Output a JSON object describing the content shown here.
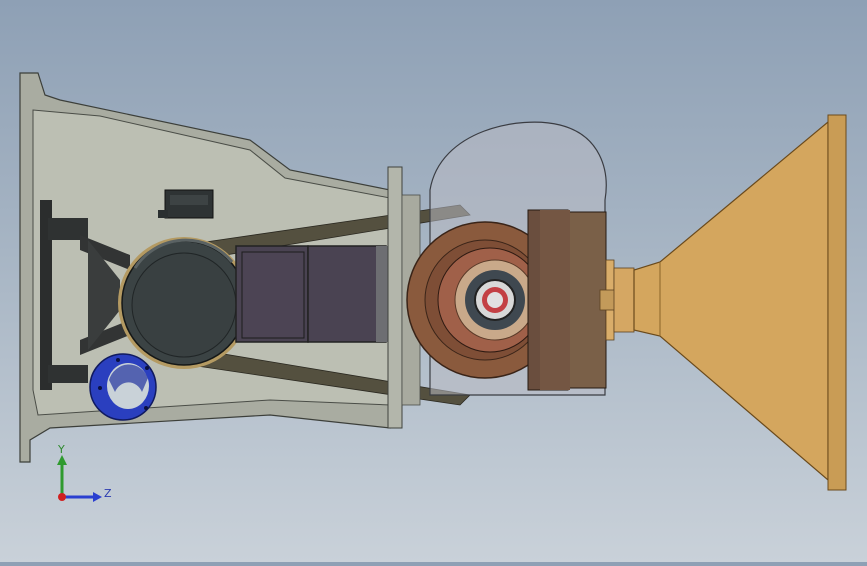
{
  "viewport": {
    "background_top": "#8ea0b5",
    "background_bottom": "#c9d1d9"
  },
  "model": {
    "housing_color": "#b9bcb0",
    "housing_edge_color": "#3c3f3a",
    "motor_color": "#3a4142",
    "panel_color": "#4b4452",
    "belt_color": "#5a5140",
    "pulley_color": "#8b5b3e",
    "flange_color": "#2540c8",
    "cone_color": "#d2a45c",
    "guard_color": "#b8bac3"
  },
  "triad": {
    "y_label": "Y",
    "z_label": "Z",
    "y_color": "#2f9a2f",
    "z_color": "#2a3fd0",
    "x_color": "#d02020"
  }
}
